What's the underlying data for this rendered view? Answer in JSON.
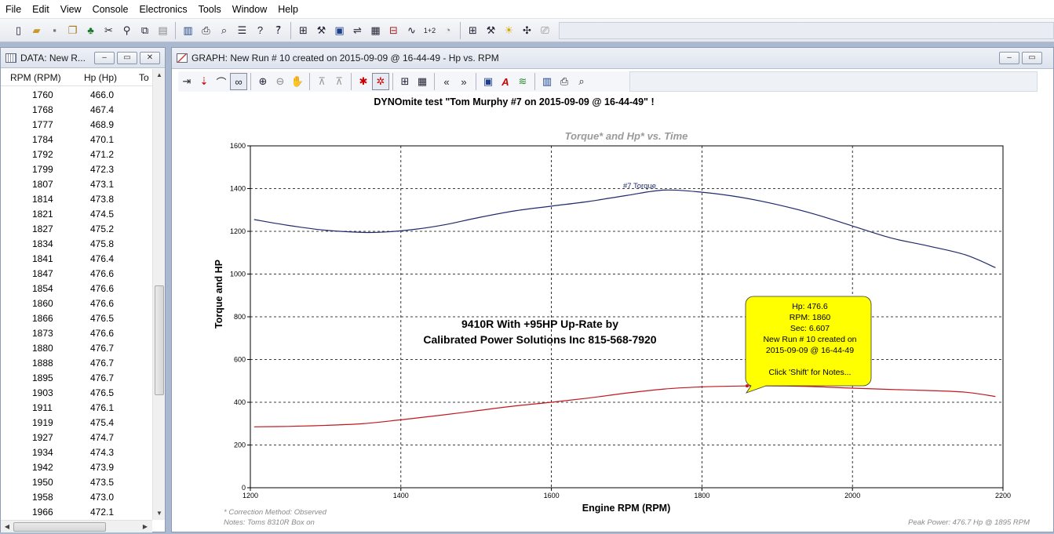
{
  "menu": [
    "File",
    "Edit",
    "View",
    "Console",
    "Electronics",
    "Tools",
    "Window",
    "Help"
  ],
  "toolbar_icons": [
    "new-icon",
    "open-icon",
    "save-icon",
    "export-icon",
    "tree-icon",
    "cut-icon",
    "find-icon",
    "copy-icon",
    "paste-icon",
    "book-icon",
    "print-icon",
    "preview-icon",
    "clipboard-icon",
    "help-icon",
    "context-help-icon",
    "graph-config-icon",
    "tools-icon",
    "chart-icon",
    "table-icon",
    "grid-icon",
    "waveform-icon",
    "sum-icon",
    "gauge-icon",
    "layout-icon",
    "wrench-icon",
    "bulb-icon",
    "settings-icon",
    "camera-icon"
  ],
  "data_window": {
    "title": "DATA: New R...",
    "columns": [
      "RPM (RPM)",
      "Hp (Hp)",
      "To"
    ],
    "rows": [
      [
        "1760",
        "466.0"
      ],
      [
        "1768",
        "467.4"
      ],
      [
        "1777",
        "468.9"
      ],
      [
        "1784",
        "470.1"
      ],
      [
        "1792",
        "471.2"
      ],
      [
        "1799",
        "472.3"
      ],
      [
        "1807",
        "473.1"
      ],
      [
        "1814",
        "473.8"
      ],
      [
        "1821",
        "474.5"
      ],
      [
        "1827",
        "475.2"
      ],
      [
        "1834",
        "475.8"
      ],
      [
        "1841",
        "476.4"
      ],
      [
        "1847",
        "476.6"
      ],
      [
        "1854",
        "476.6"
      ],
      [
        "1860",
        "476.6"
      ],
      [
        "1866",
        "476.5"
      ],
      [
        "1873",
        "476.6"
      ],
      [
        "1880",
        "476.7"
      ],
      [
        "1888",
        "476.7"
      ],
      [
        "1895",
        "476.7"
      ],
      [
        "1903",
        "476.5"
      ],
      [
        "1911",
        "476.1"
      ],
      [
        "1919",
        "475.4"
      ],
      [
        "1927",
        "474.7"
      ],
      [
        "1934",
        "474.3"
      ],
      [
        "1942",
        "473.9"
      ],
      [
        "1950",
        "473.5"
      ],
      [
        "1958",
        "473.0"
      ],
      [
        "1966",
        "472.1"
      ]
    ]
  },
  "graph_window": {
    "title": "GRAPH: New Run # 10 created on 2015-09-09 @ 16-44-49 - Hp vs. RPM",
    "toolbar_icons": [
      "pin-icon",
      "marker-icon",
      "smooth-icon",
      "binoculars-icon",
      "zoom-in-icon",
      "zoom-out-icon",
      "pan-icon",
      "scale-icon",
      "scale-alt-icon",
      "cursor-icon",
      "cursor-off-icon",
      "layout-icon",
      "table-icon",
      "prev-icon",
      "next-icon",
      "graph-icon",
      "text-icon",
      "legend-icon",
      "book-icon",
      "print-icon",
      "preview-icon"
    ]
  },
  "chart_data": {
    "type": "line",
    "title": "DYNOmite test \"Tom Murphy #7 on 2015-09-09 @ 16-44-49\" !",
    "subtitle": "Torque* and Hp* vs. Time",
    "xlabel": "Engine RPM (RPM)",
    "ylabel": "Torque and HP",
    "xlim": [
      1200,
      2200
    ],
    "ylim": [
      0,
      1600
    ],
    "xticks": [
      1200,
      1400,
      1600,
      1800,
      2000,
      2200
    ],
    "yticks": [
      0,
      200,
      400,
      600,
      800,
      1000,
      1200,
      1400,
      1600
    ],
    "grid": true,
    "series": [
      {
        "name": "#7 Torque",
        "color": "#1f2a6b",
        "x": [
          1205,
          1250,
          1300,
          1350,
          1380,
          1420,
          1460,
          1500,
          1550,
          1600,
          1650,
          1700,
          1750,
          1800,
          1850,
          1900,
          1950,
          2000,
          2050,
          2100,
          2150,
          2190
        ],
        "y": [
          1255,
          1228,
          1205,
          1195,
          1197,
          1210,
          1232,
          1262,
          1295,
          1318,
          1340,
          1368,
          1393,
          1383,
          1360,
          1325,
          1280,
          1225,
          1170,
          1132,
          1090,
          1030
        ]
      },
      {
        "name": "Hp",
        "color": "#c0181e",
        "x": [
          1205,
          1250,
          1300,
          1350,
          1400,
          1450,
          1500,
          1550,
          1600,
          1650,
          1700,
          1750,
          1800,
          1850,
          1895,
          1950,
          2000,
          2050,
          2100,
          2150,
          2190
        ],
        "y": [
          285,
          287,
          292,
          300,
          318,
          338,
          360,
          382,
          400,
          420,
          443,
          462,
          472,
          476,
          476.7,
          473,
          466,
          460,
          455,
          447,
          427
        ]
      }
    ],
    "annotations": {
      "torque_label": "#7 Torque",
      "center_text": [
        "9410R With +95HP Up-Rate by",
        "Calibrated Power Solutions Inc 815-568-7920"
      ],
      "tooltip": {
        "values": [
          "Hp:  476.6",
          "RPM:  1860",
          "Sec:  6.607"
        ],
        "lines": [
          "New Run # 10 created on",
          "2015-09-09 @ 16-44-49",
          "Click 'Shift' for Notes..."
        ],
        "rpm": 1860,
        "hp": 476.6
      },
      "correction": "* Correction Method: Observed",
      "notes": "Notes: Toms 8310R Box on",
      "peak_power": "Peak Power: 476.7 Hp @ 1895 RPM"
    }
  }
}
